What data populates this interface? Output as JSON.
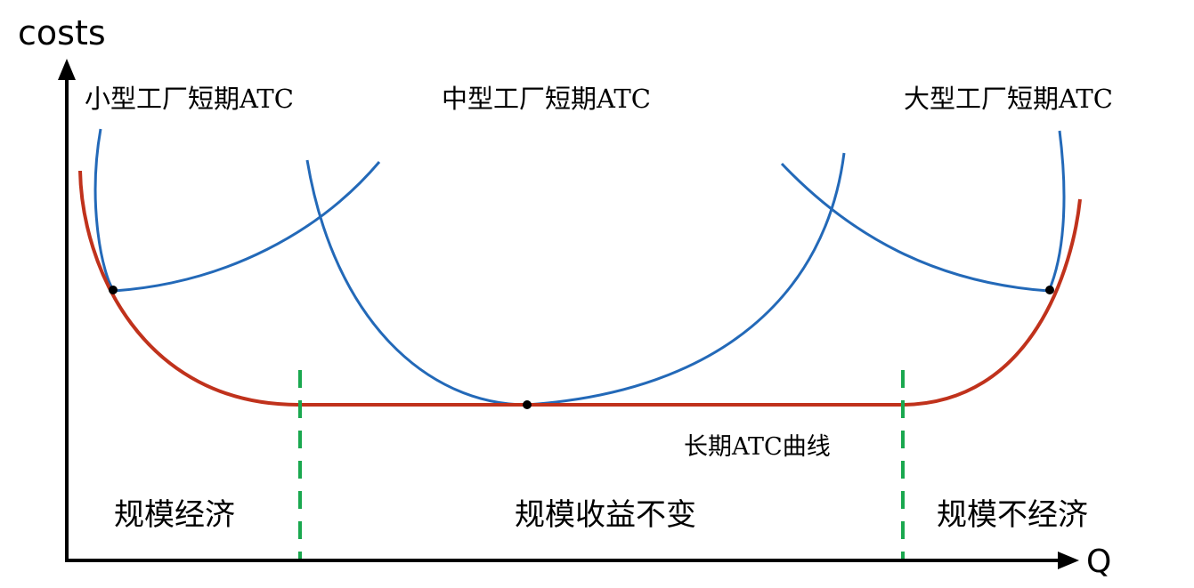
{
  "axes": {
    "y_label": "costs",
    "x_label": "Q"
  },
  "curves": {
    "small_plant_atc": {
      "label": "小型工厂短期ATC",
      "color": "#2369b8"
    },
    "medium_plant_atc": {
      "label": "中型工厂短期ATC",
      "color": "#2369b8"
    },
    "large_plant_atc": {
      "label": "大型工厂短期ATC",
      "color": "#2369b8"
    },
    "long_run_atc": {
      "label": "长期ATC曲线",
      "color": "#c0321c"
    }
  },
  "regions": {
    "left": "规模经济",
    "middle": "规模收益不变",
    "right": "规模不经济"
  },
  "colors": {
    "axis": "#000000",
    "divider": "#1aa84f",
    "tangent_point": "#000000"
  }
}
